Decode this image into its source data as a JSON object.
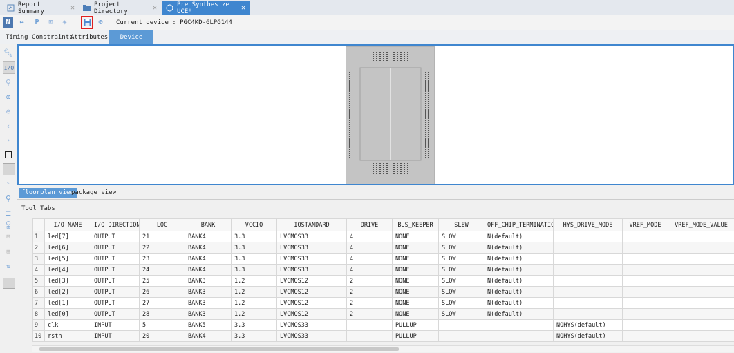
{
  "tabs": [
    {
      "label": "Report Summary",
      "icon": "report-icon"
    },
    {
      "label": "Project Directory",
      "icon": "folder-icon"
    },
    {
      "label": "Pre Synthesize UCE*",
      "icon": "constraint-icon"
    }
  ],
  "toolbar": {
    "device_label": "Current device : PGC4KD-6LPG144",
    "icons": [
      "n-icon",
      "pin-icon",
      "p-icon",
      "route-icon",
      "chip-icon",
      "save-icon",
      "check-icon"
    ],
    "n_glyph": "N",
    "p_glyph": "P"
  },
  "subtabs": [
    "Timing Constraints",
    "Attributes",
    "Device"
  ],
  "left_tools": {
    "io_label": "I/O",
    "icons": [
      "wrench-icon",
      "io-icon",
      "search-icon",
      "zoom-in-icon",
      "zoom-out-icon",
      "prev-icon",
      "next-icon",
      "square-icon",
      "grid-icon",
      "select-icon",
      "find-icon",
      "list-icon",
      "filter-icon"
    ]
  },
  "views": [
    "floorplan view",
    "package view"
  ],
  "tool_tabs_label": "Tool Tabs",
  "table": {
    "columns": [
      "",
      "I/O NAME",
      "I/O DIRECTION",
      "LOC",
      "BANK",
      "VCCIO",
      "IOSTANDARD",
      "DRIVE",
      "BUS_KEEPER",
      "SLEW",
      "OFF_CHIP_TERMINATION",
      "HYS_DRIVE_MODE",
      "VREF_MODE",
      "VREF_MODE_VALUE"
    ],
    "rows": [
      [
        "1",
        "led[7]",
        "OUTPUT",
        "21",
        "BANK4",
        "3.3",
        "LVCMOS33",
        "4",
        "NONE",
        "SLOW",
        "N(default)",
        "",
        "",
        ""
      ],
      [
        "2",
        "led[6]",
        "OUTPUT",
        "22",
        "BANK4",
        "3.3",
        "LVCMOS33",
        "4",
        "NONE",
        "SLOW",
        "N(default)",
        "",
        "",
        ""
      ],
      [
        "3",
        "led[5]",
        "OUTPUT",
        "23",
        "BANK4",
        "3.3",
        "LVCMOS33",
        "4",
        "NONE",
        "SLOW",
        "N(default)",
        "",
        "",
        ""
      ],
      [
        "4",
        "led[4]",
        "OUTPUT",
        "24",
        "BANK4",
        "3.3",
        "LVCMOS33",
        "4",
        "NONE",
        "SLOW",
        "N(default)",
        "",
        "",
        ""
      ],
      [
        "5",
        "led[3]",
        "OUTPUT",
        "25",
        "BANK3",
        "1.2",
        "LVCMOS12",
        "2",
        "NONE",
        "SLOW",
        "N(default)",
        "",
        "",
        ""
      ],
      [
        "6",
        "led[2]",
        "OUTPUT",
        "26",
        "BANK3",
        "1.2",
        "LVCMOS12",
        "2",
        "NONE",
        "SLOW",
        "N(default)",
        "",
        "",
        ""
      ],
      [
        "7",
        "led[1]",
        "OUTPUT",
        "27",
        "BANK3",
        "1.2",
        "LVCMOS12",
        "2",
        "NONE",
        "SLOW",
        "N(default)",
        "",
        "",
        ""
      ],
      [
        "8",
        "led[0]",
        "OUTPUT",
        "28",
        "BANK3",
        "1.2",
        "LVCMOS12",
        "2",
        "NONE",
        "SLOW",
        "N(default)",
        "",
        "",
        ""
      ],
      [
        "9",
        "clk",
        "INPUT",
        "5",
        "BANK5",
        "3.3",
        "LVCMOS33",
        "",
        "PULLUP",
        "",
        "",
        "NOHYS(default)",
        "",
        ""
      ],
      [
        "10",
        "rstn",
        "INPUT",
        "20",
        "BANK4",
        "3.3",
        "LVCMOS33",
        "",
        "PULLUP",
        "",
        "",
        "NOHYS(default)",
        "",
        ""
      ]
    ]
  },
  "colors": {
    "accent": "#3f86cf",
    "highlight": "#e02020"
  }
}
